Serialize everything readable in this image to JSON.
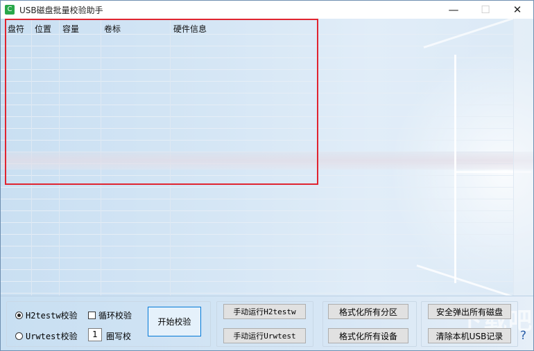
{
  "window": {
    "title": "USB磁盘批量校验助手",
    "app_icon": "C",
    "controls": {
      "minimize": "—",
      "maximize": "☐",
      "close": "✕"
    }
  },
  "table": {
    "columns": [
      "盘符",
      "位置",
      "容量",
      "卷标",
      "硬件信息"
    ],
    "rows": []
  },
  "bottom": {
    "mode_group": {
      "h2testw_label": "H2testw校验",
      "urwtest_label": "Urwtest校验",
      "selected": "H2testw校验",
      "loop_label": "循环校验",
      "loop_checked": false,
      "rounds_value": "1",
      "rounds_label": "圈写校"
    },
    "start_button": "开始校验",
    "manual_run_h2testw": "手动运行H2testw",
    "manual_run_urwtest": "手动运行Urwtest",
    "format_partitions": "格式化所有分区",
    "format_devices": "格式化所有设备",
    "eject_all": "安全弹出所有磁盘",
    "clear_usb_records": "清除本机USB记录",
    "help": "?"
  },
  "accent_colors": {
    "highlight": "#e0232f",
    "primary_border": "#0078d7"
  },
  "watermark": "下载吧"
}
